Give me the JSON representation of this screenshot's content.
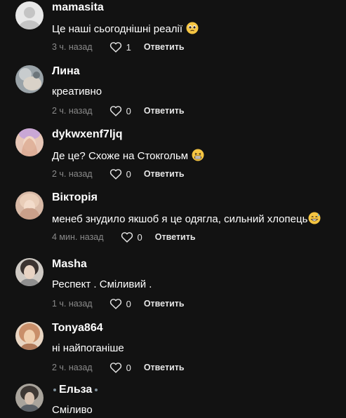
{
  "comments": [
    {
      "username": "mamasita",
      "text": "Це наші сьогоднішні реалії",
      "emoji": "pleading-face-icon",
      "time": "3 ч. назад",
      "likes": "1",
      "reply": "Ответить",
      "avatar": {
        "kind": "default",
        "colors": [
          "#e6e6e6",
          "#bdbdbd"
        ]
      }
    },
    {
      "username": "Лина",
      "text": "креативно",
      "emoji": "",
      "time": "2 ч. назад",
      "likes": "0",
      "reply": "Ответить",
      "avatar": {
        "kind": "photo",
        "colors": [
          "#9aa3a8",
          "#d9d2c8"
        ]
      }
    },
    {
      "username": "dykwxenf7ljq",
      "text": "Де це? Схоже на Стокгольм",
      "emoji": "grinning-face-icon",
      "time": "2 ч. назад",
      "likes": "0",
      "reply": "Ответить",
      "avatar": {
        "kind": "photo",
        "colors": [
          "#d9a48b",
          "#f2d7c4"
        ]
      }
    },
    {
      "username": "Вікторія",
      "text": "менеб знудило якшоб я це одягла, сильний хлопець",
      "emoji": "grinning-sweat-face-icon",
      "time": "4 мин. назад",
      "likes": "0",
      "reply": "Ответить",
      "avatar": {
        "kind": "photo",
        "colors": [
          "#caa08a",
          "#e9cdb8"
        ]
      }
    },
    {
      "username": "Masha",
      "text": "Респект . Сміливий .",
      "emoji": "",
      "time": "1 ч. назад",
      "likes": "0",
      "reply": "Ответить",
      "avatar": {
        "kind": "photo",
        "colors": [
          "#8f8f8f",
          "#d8d2cc"
        ]
      }
    },
    {
      "username": "Tonya864",
      "text": "ні найпоганіше",
      "emoji": "",
      "time": "2 ч. назад",
      "likes": "0",
      "reply": "Ответить",
      "avatar": {
        "kind": "photo",
        "colors": [
          "#c98f6a",
          "#f0cfae"
        ]
      }
    },
    {
      "username": "Ельза",
      "text": "Сміливо",
      "emoji": "",
      "time": "",
      "likes": "",
      "reply": "",
      "avatar": {
        "kind": "photo",
        "colors": [
          "#5a6066",
          "#a9a49c"
        ]
      }
    }
  ]
}
